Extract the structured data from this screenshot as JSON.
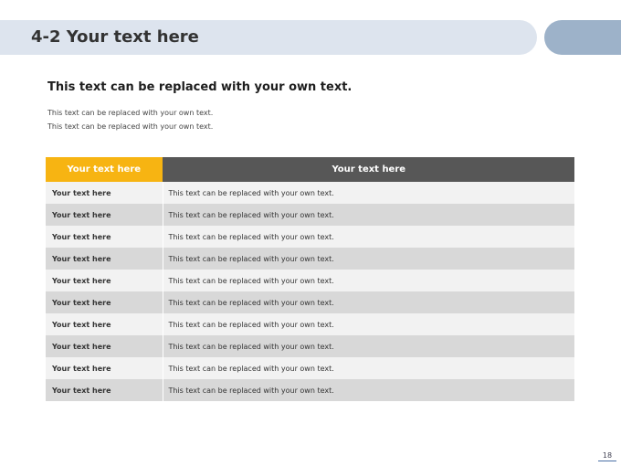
{
  "header": {
    "title": "4-2 Your text here"
  },
  "subtitle": "This text can be replaced with your own text.",
  "description": [
    "This text can be replaced with your own text.",
    "This text can be replaced with your own text."
  ],
  "table": {
    "headers": [
      "Your text here",
      "Your text here"
    ],
    "rows": [
      [
        "Your text here",
        "This text can be replaced with your own text."
      ],
      [
        "Your text here",
        "This text can be replaced with your own text."
      ],
      [
        "Your text here",
        "This text can be replaced with your own text."
      ],
      [
        "Your text here",
        "This text can be replaced with your own text."
      ],
      [
        "Your text here",
        "This text can be replaced with your own text."
      ],
      [
        "Your text here",
        "This text can be replaced with your own text."
      ],
      [
        "Your text here",
        "This text can be replaced with your own text."
      ],
      [
        "Your text here",
        "This text can be replaced with your own text."
      ],
      [
        "Your text here",
        "This text can be replaced with your own text."
      ],
      [
        "Your text here",
        "This text can be replaced with your own text."
      ]
    ]
  },
  "page_number": "18",
  "colors": {
    "accent": "#f7b412",
    "header_dark": "#575757",
    "title_bar": "#dde4ee",
    "title_pill": "#9db2c9"
  }
}
